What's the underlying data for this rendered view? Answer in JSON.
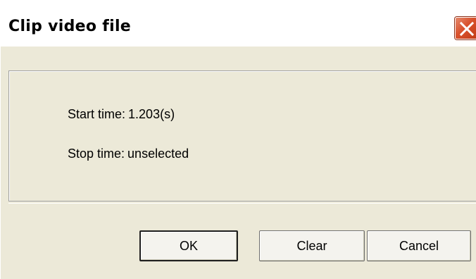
{
  "window": {
    "title": "Clip video file",
    "close_icon": "close-x-icon",
    "close_color": "#d9522d"
  },
  "panel": {
    "start_label": "Start time:",
    "start_value": "1.203(s)",
    "stop_label": "Stop time:",
    "stop_value": "unselected"
  },
  "buttons": {
    "ok": "OK",
    "clear": "Clear",
    "cancel": "Cancel"
  }
}
